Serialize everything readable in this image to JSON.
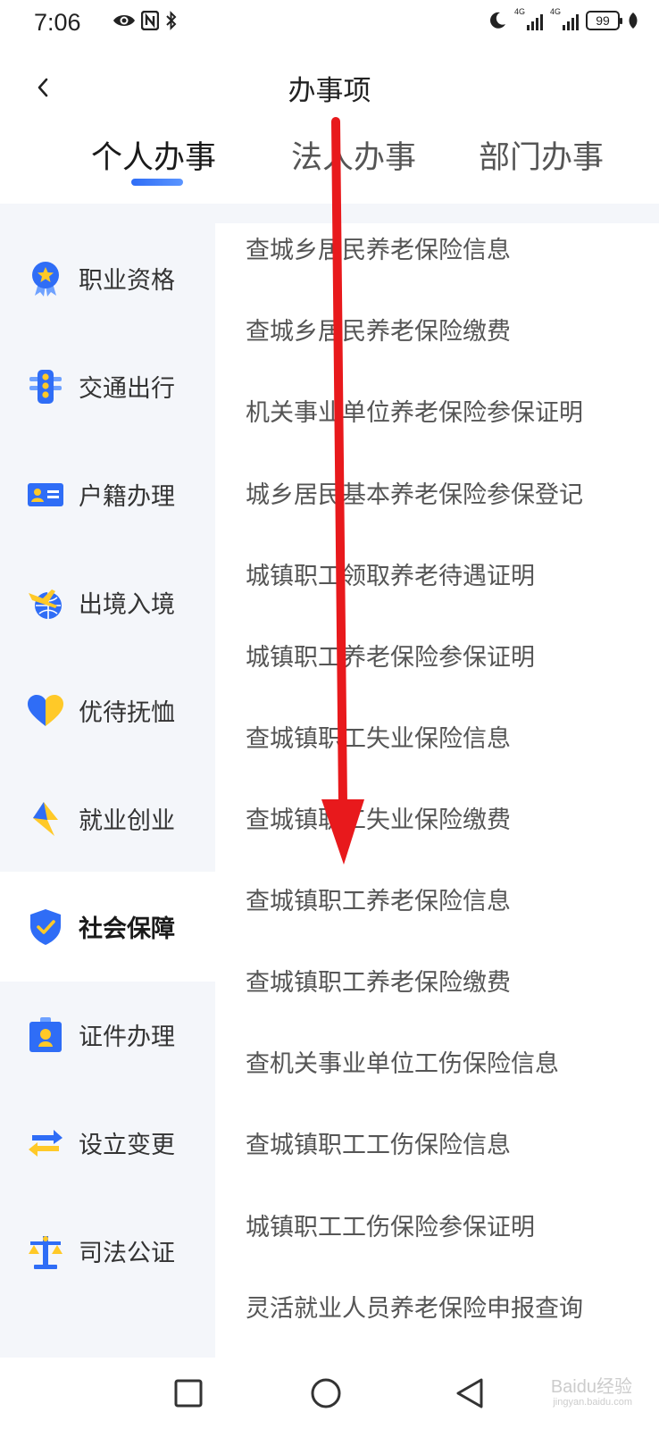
{
  "status_bar": {
    "time": "7:06",
    "network_left": "4G",
    "network_right": "4G",
    "battery": "99"
  },
  "header": {
    "title": "办事项"
  },
  "tabs": [
    {
      "label": "个人办事",
      "active": true
    },
    {
      "label": "法人办事",
      "active": false
    },
    {
      "label": "部门办事",
      "active": false
    }
  ],
  "sidebar": {
    "items": [
      {
        "label": "职业资格",
        "icon": "medal-star-icon",
        "active": false
      },
      {
        "label": "交通出行",
        "icon": "traffic-light-icon",
        "active": false
      },
      {
        "label": "户籍办理",
        "icon": "id-card-icon",
        "active": false
      },
      {
        "label": "出境入境",
        "icon": "plane-globe-icon",
        "active": false
      },
      {
        "label": "优待抚恤",
        "icon": "heart-icon",
        "active": false
      },
      {
        "label": "就业创业",
        "icon": "lightning-icon",
        "active": false
      },
      {
        "label": "社会保障",
        "icon": "shield-check-icon",
        "active": true
      },
      {
        "label": "证件办理",
        "icon": "badge-person-icon",
        "active": false
      },
      {
        "label": "设立变更",
        "icon": "swap-arrows-icon",
        "active": false
      },
      {
        "label": "司法公证",
        "icon": "scales-icon",
        "active": false
      }
    ]
  },
  "services": [
    "查城乡居民养老保险信息",
    "查城乡居民养老保险缴费",
    "机关事业单位养老保险参保证明",
    "城乡居民基本养老保险参保登记",
    "城镇职工领取养老待遇证明",
    "城镇职工养老保险参保证明",
    "查城镇职工失业保险信息",
    "查城镇职工失业保险缴费",
    "查城镇职工养老保险信息",
    "查城镇职工养老保险缴费",
    "查机关事业单位工伤保险信息",
    "查城镇职工工伤保险信息",
    "城镇职工工伤保险参保证明",
    "灵活就业人员养老保险申报查询"
  ],
  "watermark": {
    "text": "Baidu经验",
    "sub": "jingyan.baidu.com"
  },
  "colors": {
    "accent": "#2f6df6",
    "annotation_arrow": "#e8191c",
    "sidebar_bg": "#f4f6fa",
    "icon_blue": "#2f6df6",
    "icon_yellow": "#ffc928"
  }
}
